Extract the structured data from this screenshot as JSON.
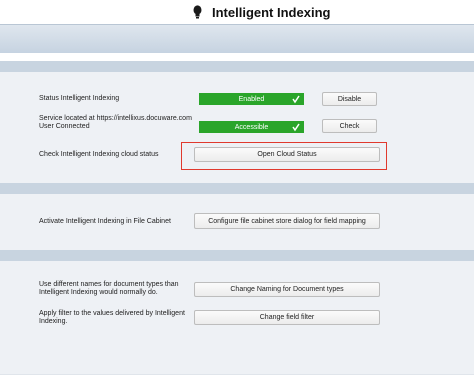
{
  "header": {
    "title": "Intelligent Indexing",
    "icon": "lightbulb-icon"
  },
  "status_section": {
    "status_label": "Status Intelligent Indexing",
    "status_value": "Enabled",
    "status_color": "#2aa52a",
    "disable_button": "Disable",
    "service_label_line1": "Service located at https://intellixus.docuware.com",
    "service_label_line2": "User Connected",
    "connection_value": "Accessible",
    "check_button": "Check",
    "cloud_label": "Check Intelligent Indexing cloud status",
    "cloud_button": "Open Cloud Status",
    "highlight_color": "#e0392e"
  },
  "activate_section": {
    "label": "Activate Intelligent Indexing in File Cabinet",
    "button": "Configure file cabinet store dialog for field mapping"
  },
  "naming_section": {
    "naming_label_line1": "Use different names for document types than",
    "naming_label_line2": "Intelligent Indexing would normally do.",
    "naming_button": "Change Naming for Document types",
    "filter_label_line1": "Apply filter to the values delivered by Intelligent",
    "filter_label_line2": "Indexing.",
    "filter_button": "Change field filter"
  }
}
